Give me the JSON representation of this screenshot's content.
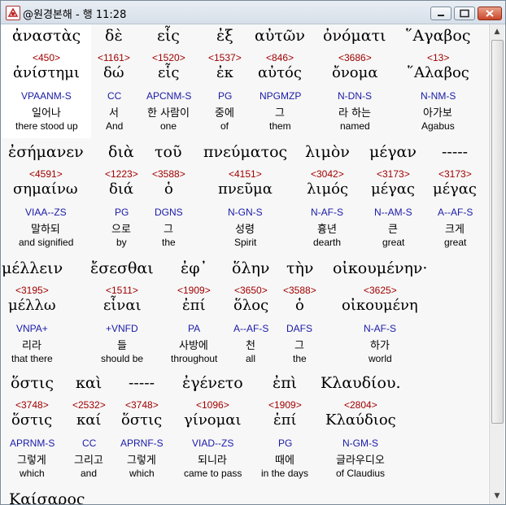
{
  "window": {
    "title": "@원경본해 - 행 11:28",
    "min_icon": "minimize-icon",
    "max_icon": "maximize-icon",
    "close_icon": "close-icon"
  },
  "rows": [
    [
      {
        "greek": "ἀναστὰς",
        "strong": "<450>",
        "lemma": "ἀνίστημι",
        "parse": "VPAANM-S",
        "korean": "일어나",
        "english": "there stood up"
      },
      {
        "greek": "δὲ",
        "strong": "<1161>",
        "lemma": "δώ",
        "parse": "CC",
        "korean": "서",
        "english": "And"
      },
      {
        "greek": "εἷς",
        "strong": "<1520>",
        "lemma": "εἷς",
        "parse": "APCNM-S",
        "korean": "한 사람이",
        "english": "one"
      },
      {
        "greek": "ἐξ",
        "strong": "<1537>",
        "lemma": "ἐκ",
        "parse": "PG",
        "korean": "중에",
        "english": "of"
      },
      {
        "greek": "αὐτῶν",
        "strong": "<846>",
        "lemma": "αὐτός",
        "parse": "NPGMZP",
        "korean": "그",
        "english": "them"
      },
      {
        "greek": "ὀνόματι",
        "strong": "<3686>",
        "lemma": "ὄνομα",
        "parse": "N-DN-S",
        "korean": "라 하는",
        "english": "named"
      },
      {
        "greek": "῞Αγαβος",
        "strong": "<13>",
        "lemma": "῞Αλαβος",
        "parse": "N-NM-S",
        "korean": "아가보",
        "english": "Agabus"
      }
    ],
    [
      {
        "greek": "ἐσήμανεν",
        "strong": "<4591>",
        "lemma": "σημαίνω",
        "parse": "VIAA--ZS",
        "korean": "말하되",
        "english": "and signified"
      },
      {
        "greek": "διὰ",
        "strong": "<1223>",
        "lemma": "διά",
        "parse": "PG",
        "korean": "으로",
        "english": "by"
      },
      {
        "greek": "τοῦ",
        "strong": "<3588>",
        "lemma": "ὁ",
        "parse": "DGNS",
        "korean": "그",
        "english": "the"
      },
      {
        "greek": "πνεύματος",
        "strong": "<4151>",
        "lemma": "πνεῦμα",
        "parse": "N-GN-S",
        "korean": "성령",
        "english": "Spirit"
      },
      {
        "greek": "λιμὸν",
        "strong": "<3042>",
        "lemma": "λιμός",
        "parse": "N-AF-S",
        "korean": "흉년",
        "english": "dearth"
      },
      {
        "greek": "μέγαν",
        "strong": "<3173>",
        "lemma": "μέγας",
        "parse": "N--AM-S",
        "korean": "큰",
        "english": "great"
      },
      {
        "greek": "-----",
        "strong": "<3173>",
        "lemma": "μέγας",
        "parse": "A--AF-S",
        "korean": "크게",
        "english": "great"
      }
    ],
    [
      {
        "greek": "μέλλειν",
        "strong": "<3195>",
        "lemma": "μέλλω",
        "parse": "VNPA+",
        "korean": "리라",
        "english": "that there"
      },
      {
        "greek": "ἔσεσθαι",
        "strong": "<1511>",
        "lemma": "εἶναι",
        "parse": "+VNFD",
        "korean": "들",
        "english": "should be"
      },
      {
        "greek": "ἐφ᾽",
        "strong": "<1909>",
        "lemma": "ἐπί",
        "parse": "PA",
        "korean": "사방에",
        "english": "throughout"
      },
      {
        "greek": "ὅλην",
        "strong": "<3650>",
        "lemma": "ὅλος",
        "parse": "A--AF-S",
        "korean": "천",
        "english": "all"
      },
      {
        "greek": "τὴν",
        "strong": "<3588>",
        "lemma": "ὁ",
        "parse": "DAFS",
        "korean": "그",
        "english": "the"
      },
      {
        "greek": "οἰκουμένην·",
        "strong": "<3625>",
        "lemma": "οἰκουμένη",
        "parse": "N-AF-S",
        "korean": "하가",
        "english": "world"
      }
    ],
    [
      {
        "greek": "ὅστις",
        "strong": "<3748>",
        "lemma": "ὅστις",
        "parse": "APRNM-S",
        "korean": "그렇게",
        "english": "which"
      },
      {
        "greek": "καὶ",
        "strong": "<2532>",
        "lemma": "καί",
        "parse": "CC",
        "korean": "그리고",
        "english": "and"
      },
      {
        "greek": "-----",
        "strong": "<3748>",
        "lemma": "ὅστις",
        "parse": "APRNF-S",
        "korean": "그렇게",
        "english": "which"
      },
      {
        "greek": "ἐγένετο",
        "strong": "<1096>",
        "lemma": "γίνομαι",
        "parse": "VIAD--ZS",
        "korean": "되니라",
        "english": "came to pass"
      },
      {
        "greek": "ἐπὶ",
        "strong": "<1909>",
        "lemma": "ἐπί",
        "parse": "PG",
        "korean": "때에",
        "english": "in the days"
      },
      {
        "greek": "Κλαυδίου.",
        "strong": "<2804>",
        "lemma": "Κλαύδιος",
        "parse": "N-GM-S",
        "korean": "글라우디오",
        "english": "of Claudius"
      }
    ],
    [
      {
        "greek": "Καίσαρος",
        "strong": "",
        "lemma": "",
        "parse": "",
        "korean": "",
        "english": ""
      }
    ]
  ]
}
